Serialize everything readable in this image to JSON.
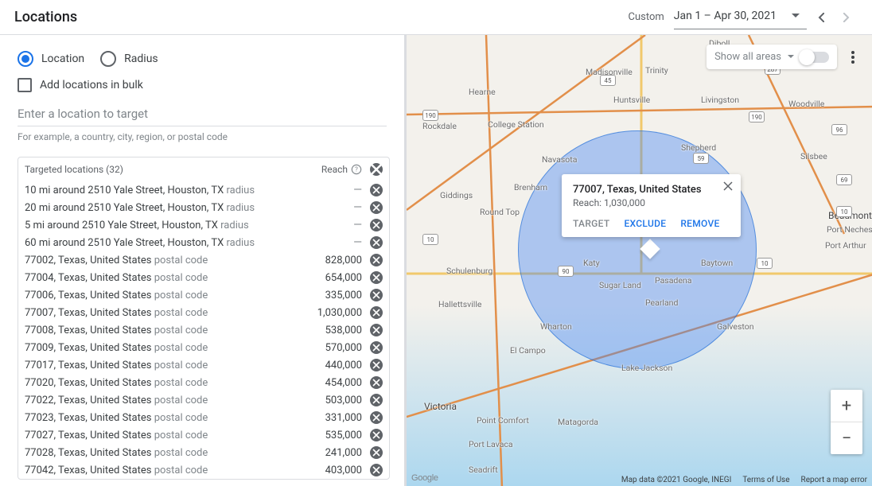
{
  "header": {
    "title": "Locations",
    "range_prefix": "Custom",
    "range": "Jan 1 – Apr 30, 2021"
  },
  "left_panel": {
    "radio_location": "Location",
    "radio_radius": "Radius",
    "bulk_label": "Add locations in bulk",
    "input_placeholder": "Enter a location to target",
    "input_hint": "For example, a country, city, region, or postal code"
  },
  "table": {
    "header_label": "Targeted locations (32)",
    "reach_label": "Reach",
    "rows": [
      {
        "name": "10 mi around 2510 Yale Street, Houston, TX",
        "type": "radius",
        "reach": null
      },
      {
        "name": "20 mi around 2510 Yale Street, Houston, TX",
        "type": "radius",
        "reach": null
      },
      {
        "name": "5 mi around 2510 Yale Street, Houston, TX",
        "type": "radius",
        "reach": null
      },
      {
        "name": "60 mi around 2510 Yale Street, Houston, TX",
        "type": "radius",
        "reach": null
      },
      {
        "name": "77002, Texas, United States",
        "type": "postal code",
        "reach": "828,000"
      },
      {
        "name": "77004, Texas, United States",
        "type": "postal code",
        "reach": "654,000"
      },
      {
        "name": "77006, Texas, United States",
        "type": "postal code",
        "reach": "335,000"
      },
      {
        "name": "77007, Texas, United States",
        "type": "postal code",
        "reach": "1,030,000"
      },
      {
        "name": "77008, Texas, United States",
        "type": "postal code",
        "reach": "538,000"
      },
      {
        "name": "77009, Texas, United States",
        "type": "postal code",
        "reach": "570,000"
      },
      {
        "name": "77017, Texas, United States",
        "type": "postal code",
        "reach": "440,000"
      },
      {
        "name": "77020, Texas, United States",
        "type": "postal code",
        "reach": "454,000"
      },
      {
        "name": "77022, Texas, United States",
        "type": "postal code",
        "reach": "503,000"
      },
      {
        "name": "77023, Texas, United States",
        "type": "postal code",
        "reach": "331,000"
      },
      {
        "name": "77027, Texas, United States",
        "type": "postal code",
        "reach": "535,000"
      },
      {
        "name": "77028, Texas, United States",
        "type": "postal code",
        "reach": "241,000"
      },
      {
        "name": "77042, Texas, United States",
        "type": "postal code",
        "reach": "403,000"
      }
    ]
  },
  "map": {
    "show_areas_label": "Show all areas",
    "popup_title": "77007, Texas, United States",
    "popup_reach": "Reach: 1,030,000",
    "popup_target": "TARGET",
    "popup_exclude": "EXCLUDE",
    "popup_remove": "REMOVE",
    "attribution": "Map data ©2021 Google, INEGI",
    "terms": "Terms of Use",
    "report": "Report a map error",
    "logo": "Google",
    "cities": {
      "diboll": "Diboll",
      "madisonville": "Madisonville",
      "trinity": "Trinity",
      "hearne": "Hearne",
      "huntsville": "Huntsville",
      "livingston": "Livingston",
      "woodville": "Woodville",
      "rockdale": "Rockdale",
      "collegestation": "College Station",
      "shepherd": "Shepherd",
      "silsbee": "Silsbee",
      "navasota": "Navasota",
      "brenham": "Brenham",
      "giddings": "Giddings",
      "roundtop": "Round Top",
      "beaumont": "Beaumont",
      "portneches": "Port Neches",
      "portarthur": "Port Arthur",
      "schulenburg": "Schulenburg",
      "hallettsville": "Hallettsville",
      "sugarland": "Sugar Land",
      "pasadena": "Pasadena",
      "baytown": "Baytown",
      "pearland": "Pearland",
      "galveston": "Galveston",
      "wharton": "Wharton",
      "elcampo": "El Campo",
      "lakejackson": "Lake Jackson",
      "victoria": "Victoria",
      "pointcomfort": "Point Comfort",
      "matagorda": "Matagorda",
      "portlavaca": "Port Lavaca",
      "seadrift": "Seadrift",
      "katy": "Katy"
    },
    "shields": {
      "s45": "45",
      "s287": "287",
      "s190a": "190",
      "s190b": "190",
      "s59": "59",
      "s96": "96",
      "s10a": "10",
      "s10b": "10",
      "s10c": "10",
      "s90": "90",
      "s69": "69"
    }
  }
}
